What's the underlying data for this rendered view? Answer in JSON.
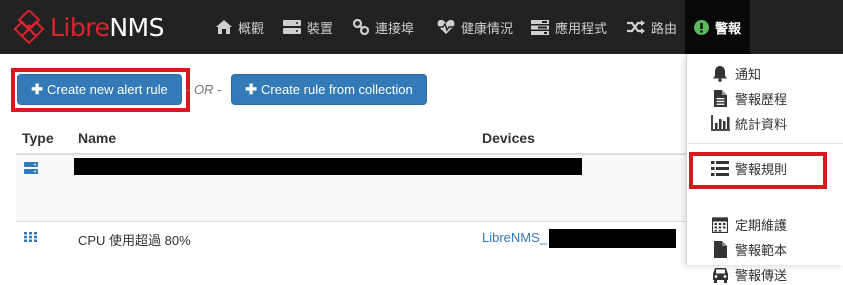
{
  "brand": {
    "part1": "Libre",
    "part2": "NMS"
  },
  "nav": {
    "overview": "概觀",
    "devices": "裝置",
    "ports": "連接埠",
    "health": "健康情況",
    "apps": "應用程式",
    "routing": "路由",
    "alerts": "警報"
  },
  "actions": {
    "create_alert_rule": "Create new alert rule",
    "separator": "- OR -",
    "create_from_collection": "Create rule from collection"
  },
  "table": {
    "columns": [
      "Type",
      "Name",
      "Devices"
    ],
    "rows": [
      {
        "type_icon": "server-icon",
        "name": "",
        "devices": ""
      },
      {
        "type_icon": "grid-icon",
        "name": "CPU 使用超過 80%",
        "devices": "LibreNMS_"
      }
    ]
  },
  "alerts_menu": {
    "items": [
      {
        "label": "通知",
        "icon": "bell-icon"
      },
      {
        "label": "警報歷程",
        "icon": "file-icon"
      },
      {
        "label": "統計資料",
        "icon": "bar-chart-icon"
      },
      {
        "label": "警報規則",
        "icon": "list-icon"
      },
      {
        "label": "定期維護",
        "icon": "calendar-icon"
      },
      {
        "label": "警報範本",
        "icon": "file-blank-icon"
      },
      {
        "label": "警報傳送",
        "icon": "car-icon"
      }
    ]
  },
  "colors": {
    "navbar": "#222222",
    "brand_red": "#d9232e",
    "primary_button": "#337ab7",
    "highlight_red": "#d71920"
  }
}
